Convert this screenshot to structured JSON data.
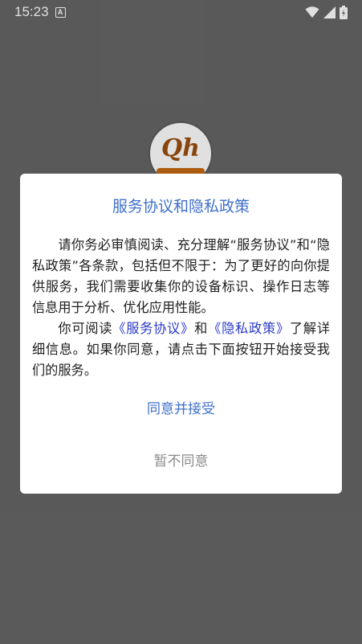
{
  "status_bar": {
    "time": "15:23",
    "notification_icon": "A",
    "icons": [
      "wifi-icon",
      "signal-icon",
      "battery-icon"
    ]
  },
  "app_logo": {
    "text": "Qh"
  },
  "dialog": {
    "title": "服务协议和隐私政策",
    "paragraph1": "请你务必审慎阅读、充分理解“服务协议”和“隐私政策”各条款，包括但不限于：为了更好的向你提供服务，我们需要收集你的设备标识、操作日志等信息用于分析、优化应用性能。",
    "paragraph2": {
      "prefix": "你可阅读",
      "link_service": "《服务协议》",
      "middle": "和",
      "link_privacy": "《隐私政策》",
      "suffix": "了解详细信息。如果你同意，请点击下面按钮开始接受我们的服务。"
    },
    "agree_label": "同意并接受",
    "disagree_label": "暂不同意"
  },
  "colors": {
    "background": "#666666",
    "title": "#3f6fc9",
    "link": "#2a39c6",
    "disagree": "#8a8a8a",
    "logo_accent": "#c56a12"
  }
}
